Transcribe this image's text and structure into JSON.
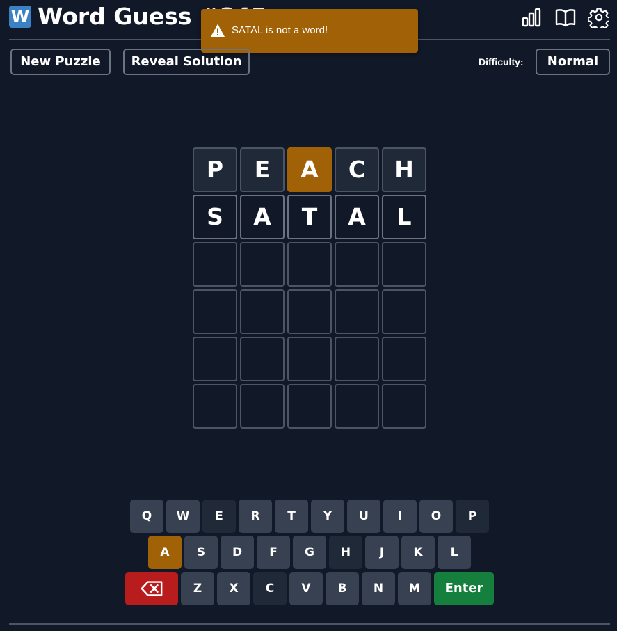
{
  "header": {
    "logo_letter": "W",
    "title": "Word Guess #845",
    "icons": [
      "stats-icon",
      "book-icon",
      "settings-icon"
    ]
  },
  "toast": {
    "message": "SATAL is not a word!",
    "icon": "warning-icon",
    "color": "#a16207"
  },
  "toolbar": {
    "new_puzzle": "New Puzzle",
    "reveal_solution": "Reveal Solution",
    "difficulty_label": "Difficulty:",
    "difficulty_value": "Normal"
  },
  "board": {
    "rows": [
      [
        {
          "l": "P",
          "s": "absent"
        },
        {
          "l": "E",
          "s": "absent"
        },
        {
          "l": "A",
          "s": "present"
        },
        {
          "l": "C",
          "s": "absent"
        },
        {
          "l": "H",
          "s": "absent"
        }
      ],
      [
        {
          "l": "S",
          "s": "filled"
        },
        {
          "l": "A",
          "s": "filled"
        },
        {
          "l": "T",
          "s": "filled"
        },
        {
          "l": "A",
          "s": "filled"
        },
        {
          "l": "L",
          "s": "filled"
        }
      ],
      [
        {
          "l": "",
          "s": "empty"
        },
        {
          "l": "",
          "s": "empty"
        },
        {
          "l": "",
          "s": "empty"
        },
        {
          "l": "",
          "s": "empty"
        },
        {
          "l": "",
          "s": "empty"
        }
      ],
      [
        {
          "l": "",
          "s": "empty"
        },
        {
          "l": "",
          "s": "empty"
        },
        {
          "l": "",
          "s": "empty"
        },
        {
          "l": "",
          "s": "empty"
        },
        {
          "l": "",
          "s": "empty"
        }
      ],
      [
        {
          "l": "",
          "s": "empty"
        },
        {
          "l": "",
          "s": "empty"
        },
        {
          "l": "",
          "s": "empty"
        },
        {
          "l": "",
          "s": "empty"
        },
        {
          "l": "",
          "s": "empty"
        }
      ],
      [
        {
          "l": "",
          "s": "empty"
        },
        {
          "l": "",
          "s": "empty"
        },
        {
          "l": "",
          "s": "empty"
        },
        {
          "l": "",
          "s": "empty"
        },
        {
          "l": "",
          "s": "empty"
        }
      ]
    ]
  },
  "keyboard": {
    "row1": [
      {
        "k": "Q",
        "s": "normal"
      },
      {
        "k": "W",
        "s": "normal"
      },
      {
        "k": "E",
        "s": "used"
      },
      {
        "k": "R",
        "s": "normal"
      },
      {
        "k": "T",
        "s": "normal"
      },
      {
        "k": "Y",
        "s": "normal"
      },
      {
        "k": "U",
        "s": "normal"
      },
      {
        "k": "I",
        "s": "normal"
      },
      {
        "k": "O",
        "s": "normal"
      },
      {
        "k": "P",
        "s": "used"
      }
    ],
    "row2": [
      {
        "k": "A",
        "s": "present"
      },
      {
        "k": "S",
        "s": "normal"
      },
      {
        "k": "D",
        "s": "normal"
      },
      {
        "k": "F",
        "s": "normal"
      },
      {
        "k": "G",
        "s": "normal"
      },
      {
        "k": "H",
        "s": "used"
      },
      {
        "k": "J",
        "s": "normal"
      },
      {
        "k": "K",
        "s": "normal"
      },
      {
        "k": "L",
        "s": "normal"
      }
    ],
    "row3": [
      {
        "k": "Z",
        "s": "normal"
      },
      {
        "k": "X",
        "s": "normal"
      },
      {
        "k": "C",
        "s": "used"
      },
      {
        "k": "V",
        "s": "normal"
      },
      {
        "k": "B",
        "s": "normal"
      },
      {
        "k": "N",
        "s": "normal"
      },
      {
        "k": "M",
        "s": "normal"
      }
    ],
    "enter_label": "Enter",
    "backspace_icon": "backspace-icon"
  }
}
